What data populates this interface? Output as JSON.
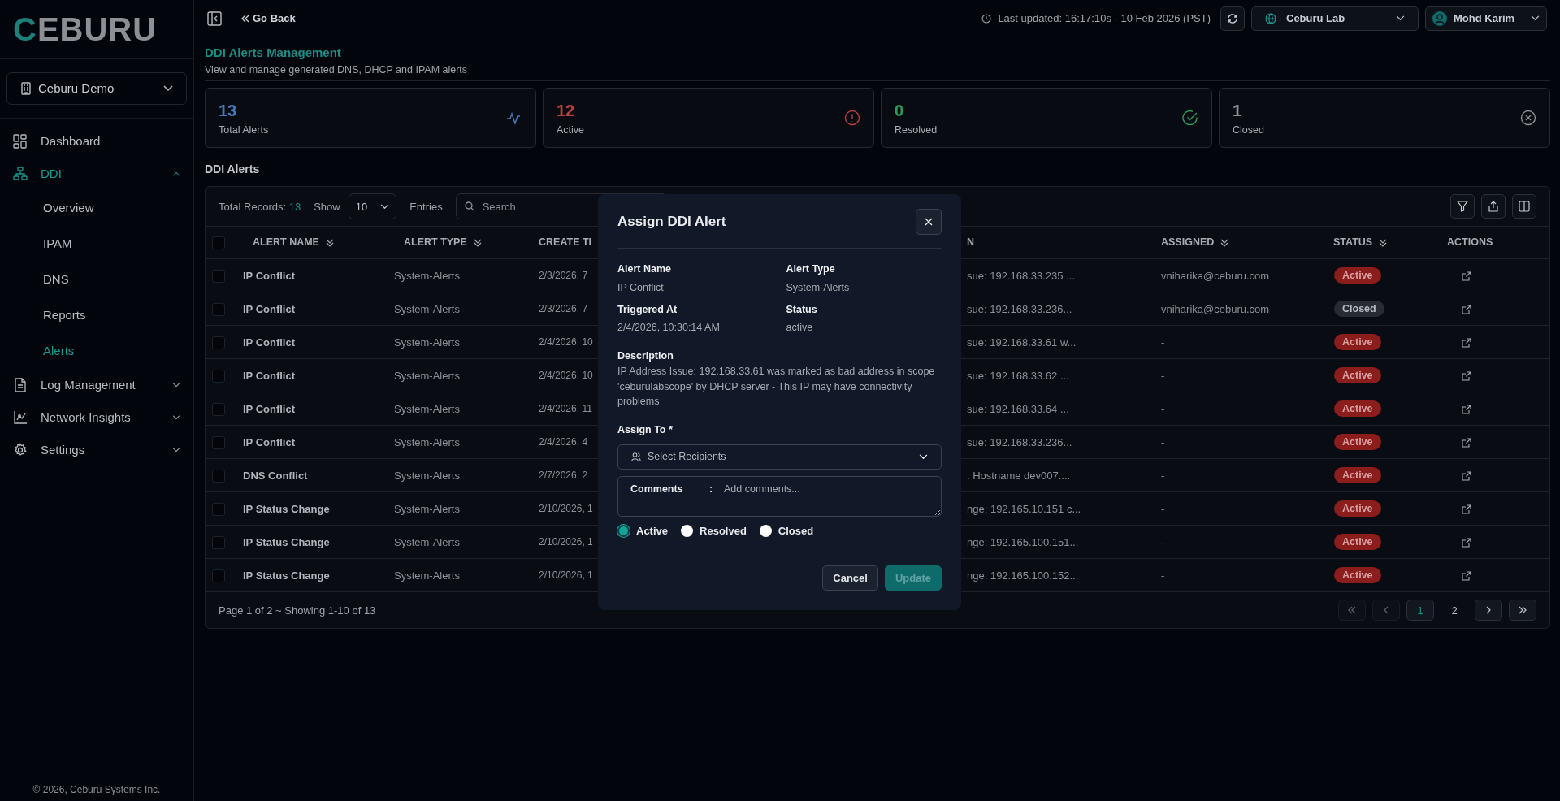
{
  "sidebar": {
    "logo": "CEBURU",
    "org": "Ceburu Demo",
    "items": [
      {
        "label": "Dashboard",
        "selected": false
      },
      {
        "label": "DDI",
        "selected": true,
        "expanded": true,
        "children": [
          {
            "label": "Overview",
            "selected": false
          },
          {
            "label": "IPAM",
            "selected": false
          },
          {
            "label": "DNS",
            "selected": false
          },
          {
            "label": "Reports",
            "selected": false
          },
          {
            "label": "Alerts",
            "selected": true
          }
        ]
      },
      {
        "label": "Log Management",
        "selected": false,
        "expanded": false
      },
      {
        "label": "Network Insights",
        "selected": false,
        "expanded": false
      },
      {
        "label": "Settings",
        "selected": false,
        "expanded": false
      }
    ],
    "footer": "© 2026, Ceburu Systems Inc."
  },
  "header": {
    "back": "Go Back",
    "last_updated": "Last updated: 16:17:10s - 10 Feb 2026 (PST)",
    "site": "Ceburu Lab",
    "user": "Mohd Karim"
  },
  "page": {
    "title": "DDI Alerts Management",
    "subtitle": "View and manage generated DNS, DHCP and IPAM alerts"
  },
  "stats": [
    {
      "value": "13",
      "label": "Total Alerts",
      "color": "#4a78b8"
    },
    {
      "value": "12",
      "label": "Active",
      "color": "#b8413f"
    },
    {
      "value": "0",
      "label": "Resolved",
      "color": "#2f9a5c"
    },
    {
      "value": "1",
      "label": "Closed",
      "color": "#8a8f98"
    }
  ],
  "section_title": "DDI Alerts",
  "table": {
    "total_label": "Total Records:",
    "total": "13",
    "show": "Show",
    "page_size": "10",
    "entries": "Entries",
    "search": {
      "placeholder": "Search"
    },
    "select_all": false,
    "columns": [
      "ALERT NAME",
      "ALERT TYPE",
      "CREATE TI",
      "N",
      "ASSIGNED",
      "STATUS",
      "ACTIONS"
    ],
    "rows": [
      {
        "checked": false,
        "name": "IP Conflict",
        "type": "System-Alerts",
        "created": "2/3/2026, 7",
        "description": "sue: 192.168.33.235 ...",
        "assigned": "vniharika@ceburu.com",
        "status": "Active",
        "color": "#8b1d1d"
      },
      {
        "checked": false,
        "name": "IP Conflict",
        "type": "System-Alerts",
        "created": "2/3/2026, 7",
        "description": "sue: 192.168.33.236...",
        "assigned": "vniharika@ceburu.com",
        "status": "Closed",
        "color": "#262b34"
      },
      {
        "checked": false,
        "name": "IP Conflict",
        "type": "System-Alerts",
        "created": "2/4/2026, 10",
        "description": "sue: 192.168.33.61 w...",
        "assigned": "-",
        "status": "Active",
        "color": "#8b1d1d"
      },
      {
        "checked": false,
        "name": "IP Conflict",
        "type": "System-Alerts",
        "created": "2/4/2026, 10",
        "description": "sue: 192.168.33.62 ...",
        "assigned": "-",
        "status": "Active",
        "color": "#8b1d1d"
      },
      {
        "checked": false,
        "name": "IP Conflict",
        "type": "System-Alerts",
        "created": "2/4/2026, 11",
        "description": "sue: 192.168.33.64 ...",
        "assigned": "-",
        "status": "Active",
        "color": "#8b1d1d"
      },
      {
        "checked": false,
        "name": "IP Conflict",
        "type": "System-Alerts",
        "created": "2/4/2026, 4",
        "description": "sue: 192.168.33.236...",
        "assigned": "-",
        "status": "Active",
        "color": "#8b1d1d"
      },
      {
        "checked": false,
        "name": "DNS Conflict",
        "type": "System-Alerts",
        "created": "2/7/2026, 2",
        "description": ": Hostname dev007....",
        "assigned": "-",
        "status": "Active",
        "color": "#8b1d1d"
      },
      {
        "checked": false,
        "name": "IP Status Change",
        "type": "System-Alerts",
        "created": "2/10/2026, 1",
        "description": "nge: 192.165.10.151 c...",
        "assigned": "-",
        "status": "Active",
        "color": "#8b1d1d"
      },
      {
        "checked": false,
        "name": "IP Status Change",
        "type": "System-Alerts",
        "created": "2/10/2026, 1",
        "description": "nge: 192.165.100.151...",
        "assigned": "-",
        "status": "Active",
        "color": "#8b1d1d"
      },
      {
        "checked": false,
        "name": "IP Status Change",
        "type": "System-Alerts",
        "created": "2/10/2026, 1",
        "description": "nge: 192.165.100.152...",
        "assigned": "-",
        "status": "Active",
        "color": "#8b1d1d"
      }
    ],
    "footer": "Page 1 of 2 ~ Showing 1-10 of 13",
    "pagination": {
      "first_disabled": true,
      "prev_disabled": true,
      "pages": [
        {
          "label": "1",
          "selected": true
        },
        {
          "label": "2",
          "selected": false
        }
      ],
      "next_disabled": false,
      "last_disabled": false
    }
  },
  "modal": {
    "title": "Assign DDI Alert",
    "fields": [
      {
        "label": "Alert Name",
        "value": "IP Conflict"
      },
      {
        "label": "Alert Type",
        "value": "System-Alerts"
      },
      {
        "label": "Triggered At",
        "value": "2/4/2026, 10:30:14 AM"
      },
      {
        "label": "Status",
        "value": "active"
      }
    ],
    "description_label": "Description",
    "description": "IP Address Issue: 192.168.33.61 was marked as bad address in scope 'ceburulabscope' by DHCP server - This IP may have connectivity problems",
    "assign_label": "Assign To *",
    "recipients": {
      "placeholder": "Select Recipients"
    },
    "comments": {
      "label": "Comments",
      "separator": ":",
      "placeholder": "Add comments..."
    },
    "statuses": [
      {
        "label": "Active",
        "selected": true
      },
      {
        "label": "Resolved",
        "selected": false
      },
      {
        "label": "Closed",
        "selected": false
      }
    ],
    "buttons": [
      {
        "label": "Cancel",
        "kind": "secondary",
        "disabled": false
      },
      {
        "label": "Update",
        "kind": "primary",
        "disabled": true
      }
    ]
  }
}
